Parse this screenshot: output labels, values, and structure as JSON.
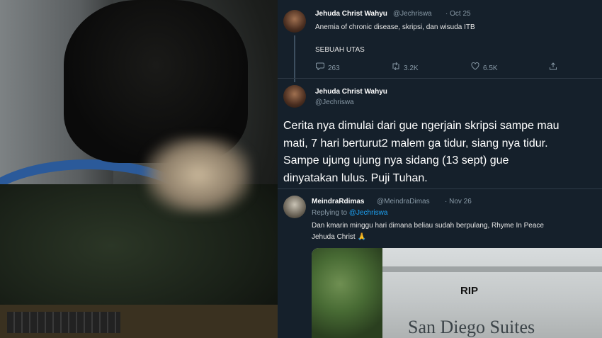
{
  "tweet1": {
    "name": "Jehuda Christ Wahyu",
    "handle": "@Jechriswa",
    "date": "· Oct 25",
    "line1": "Anemia of chronic disease, skripsi, dan wisuda ITB",
    "line2": "SEBUAH UTAS",
    "replies": "263",
    "retweets": "3.2K",
    "likes": "6.5K"
  },
  "tweet2": {
    "name": "Jehuda Christ Wahyu",
    "handle": "@Jechriswa",
    "text_lines": [
      "Cerita nya dimulai dari gue ngerjain skripsi sampe mau",
      "mati, 7 hari berturut2 malem ga tidur, siang nya tidur.",
      "Sampe ujung ujung nya sidang (13 sept) gue",
      "dinyatakan lulus. Puji Tuhan."
    ]
  },
  "reply": {
    "name": "MeindraRdimas",
    "handle": "@MeindraDimas",
    "date": "· Nov 26",
    "replying_prefix": "Replying to",
    "replying_to": "@Jechriswa",
    "line1": "Dan kmarin minggu hari dimana beliau sudah berpulang, Rhyme In Peace",
    "line2": "Jehuda Christ 🙏"
  },
  "image": {
    "rip": "RIP",
    "sign": "San Diego Suites"
  },
  "icons": {
    "reply": "reply-icon",
    "retweet": "retweet-icon",
    "like": "heart-icon",
    "share": "share-icon"
  },
  "colors": {
    "background": "#15202b",
    "link": "#1da1f2",
    "muted": "#8899a6"
  }
}
